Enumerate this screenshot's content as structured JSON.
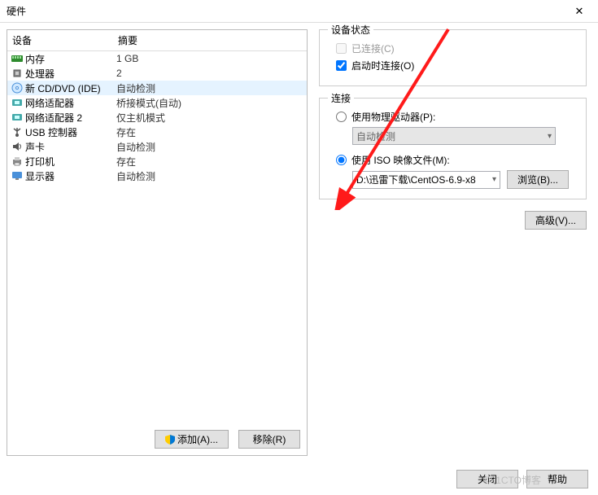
{
  "title": "硬件",
  "columns": {
    "device": "设备",
    "summary": "摘要"
  },
  "devices": [
    {
      "icon": "memory-icon",
      "label": "内存",
      "summary": "1 GB"
    },
    {
      "icon": "cpu-icon",
      "label": "处理器",
      "summary": "2"
    },
    {
      "icon": "disc-icon",
      "label": "新 CD/DVD (IDE)",
      "summary": "自动检测",
      "selected": true
    },
    {
      "icon": "nic-icon",
      "label": "网络适配器",
      "summary": "桥接模式(自动)"
    },
    {
      "icon": "nic-icon",
      "label": "网络适配器 2",
      "summary": "仅主机模式"
    },
    {
      "icon": "usb-icon",
      "label": "USB 控制器",
      "summary": "存在"
    },
    {
      "icon": "sound-icon",
      "label": "声卡",
      "summary": "自动检测"
    },
    {
      "icon": "printer-icon",
      "label": "打印机",
      "summary": "存在"
    },
    {
      "icon": "display-icon",
      "label": "显示器",
      "summary": "自动检测"
    }
  ],
  "left_buttons": {
    "add": "添加(A)...",
    "remove": "移除(R)"
  },
  "status_group": {
    "title": "设备状态",
    "connected": "已连接(C)",
    "connect_on_start": "启动时连接(O)"
  },
  "connection_group": {
    "title": "连接",
    "physical_drive": "使用物理驱动器(P):",
    "physical_value": "自动检测",
    "iso_file": "使用 ISO 映像文件(M):",
    "iso_value": "D:\\迅雷下载\\CentOS-6.9-x8",
    "browse": "浏览(B)..."
  },
  "advanced_btn": "高级(V)...",
  "footer": {
    "close": "关闭",
    "help": "帮助"
  },
  "watermark": "©51CTO博客"
}
